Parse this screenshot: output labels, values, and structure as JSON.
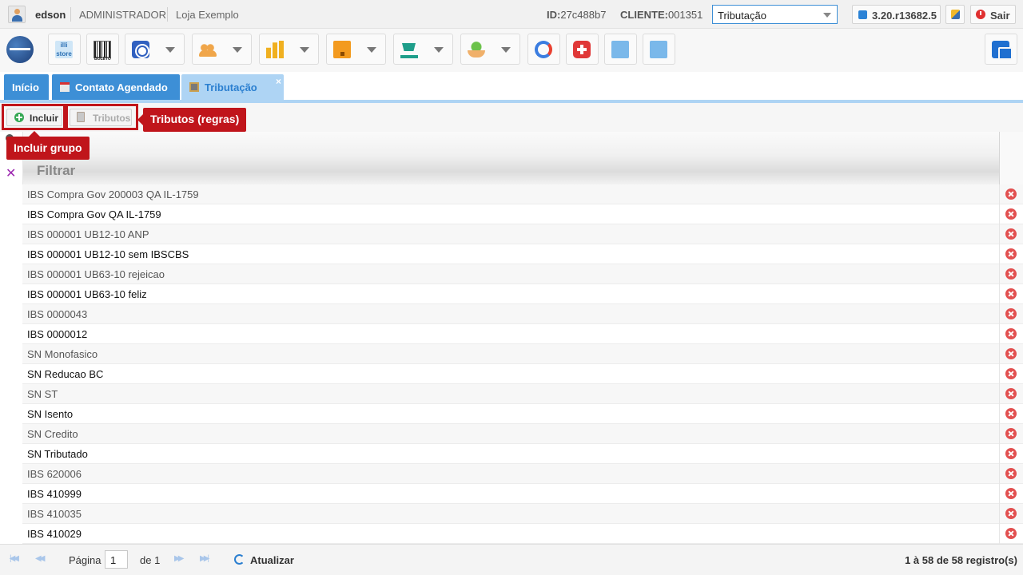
{
  "topbar": {
    "user": "edson",
    "role": "ADMINISTRADOR",
    "store": "Loja Exemplo",
    "id_label": "ID:",
    "id_value": "27c488b7",
    "client_label": "CLIENTE:",
    "client_value": "001351",
    "module_select": "Tributação",
    "version": "3.20.r13682.5",
    "exit_label": "Sair"
  },
  "toolbar": {
    "store_badge": "illi store",
    "barcode_caption": "BOLETO"
  },
  "tabs": [
    {
      "label": "Início"
    },
    {
      "label": "Contato Agendado"
    },
    {
      "label": "Tributação"
    }
  ],
  "actions": {
    "include_label": "Incluir",
    "tributos_label": "Tributos"
  },
  "annotations": {
    "tributos_callout": "Tributos (regras)",
    "include_callout": "Incluir grupo"
  },
  "grid": {
    "filter_label": "Filtrar",
    "rows": [
      "IBS Compra Gov 200003 QA IL-1759",
      "IBS Compra Gov QA IL-1759",
      "IBS 000001 UB12-10 ANP",
      "IBS 000001 UB12-10 sem IBSCBS",
      "IBS 000001 UB63-10 rejeicao",
      "IBS 000001 UB63-10 feliz",
      "IBS 0000043",
      "IBS 0000012",
      "SN Monofasico",
      "SN Reducao BC",
      "SN ST",
      "SN Isento",
      "SN Credito",
      "SN Tributado",
      "IBS 620006",
      "IBS 410999",
      "IBS 410035",
      "IBS 410029"
    ]
  },
  "footer": {
    "page_label": "Página",
    "page_value": "1",
    "page_of": "de 1",
    "refresh_label": "Atualizar",
    "record_count": "1 à 58 de 58 registro(s)"
  },
  "colors": {
    "accent": "#3d8fd6",
    "highlight": "#c0151b",
    "delete": "#e25050"
  }
}
